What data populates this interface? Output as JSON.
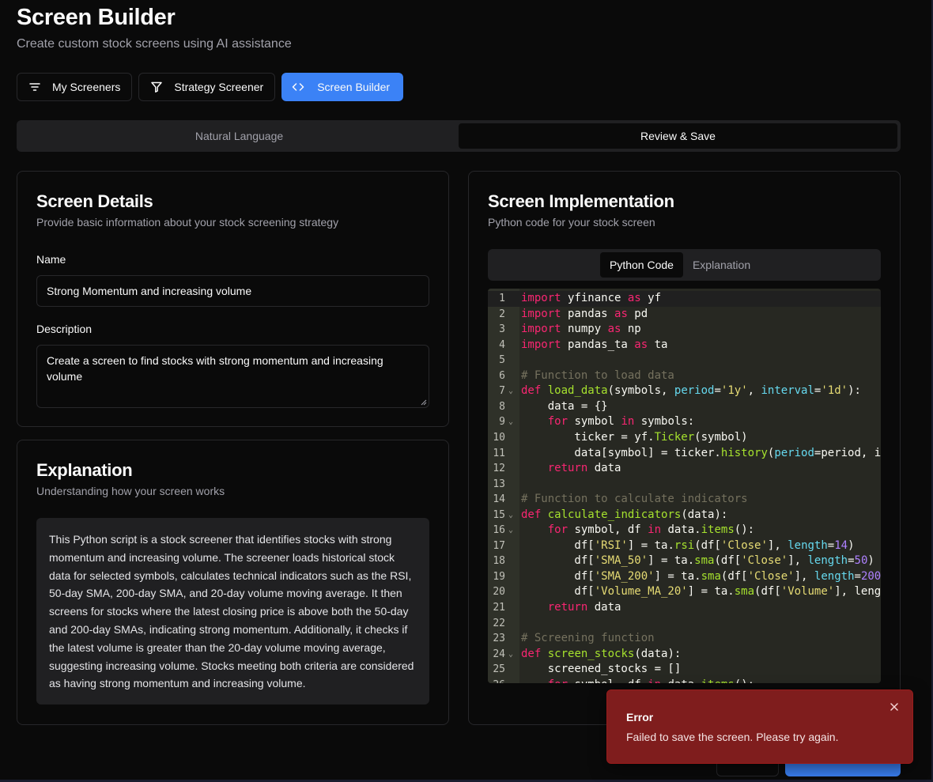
{
  "header": {
    "title": "Screen Builder",
    "subtitle": "Create custom stock screens using AI assistance"
  },
  "nav": {
    "items": [
      {
        "label": "My Screeners",
        "icon": "filter-lines-icon",
        "active": false
      },
      {
        "label": "Strategy Screener",
        "icon": "funnel-icon",
        "active": false
      },
      {
        "label": "Screen Builder",
        "icon": "code-icon",
        "active": true
      }
    ]
  },
  "tabs": [
    {
      "label": "Natural Language",
      "active": false
    },
    {
      "label": "Review & Save",
      "active": true
    }
  ],
  "details": {
    "title": "Screen Details",
    "description": "Provide basic information about your stock screening strategy",
    "name_label": "Name",
    "name_value": "Strong Momentum and increasing volume",
    "description_label": "Description",
    "description_value": "Create a screen to find stocks with strong momentum and increasing volume"
  },
  "explanation": {
    "title": "Explanation",
    "description": "Understanding how your screen works",
    "text": "This Python script is a stock screener that identifies stocks with strong momentum and increasing volume. The screener loads historical stock data for selected symbols, calculates technical indicators such as the RSI, 50-day SMA, 200-day SMA, and 20-day volume moving average. It then screens for stocks where the latest closing price is above both the 50-day and 200-day SMAs, indicating strong momentum. Additionally, it checks if the latest volume is greater than the 20-day volume moving average, suggesting increasing volume. Stocks meeting both criteria are considered as having strong momentum and increasing volume."
  },
  "implementation": {
    "title": "Screen Implementation",
    "description": "Python code for your stock screen",
    "tabs": [
      {
        "label": "Python Code",
        "active": true
      },
      {
        "label": "Explanation",
        "active": false
      }
    ],
    "code_lines": [
      "import yfinance as yf",
      "import pandas as pd",
      "import numpy as np",
      "import pandas_ta as ta",
      "",
      "# Function to load data",
      "def load_data(symbols, period='1y', interval='1d'):",
      "    data = {}",
      "    for symbol in symbols:",
      "        ticker = yf.Ticker(symbol)",
      "        data[symbol] = ticker.history(period=period, i",
      "    return data",
      "",
      "# Function to calculate indicators",
      "def calculate_indicators(data):",
      "    for symbol, df in data.items():",
      "        df['RSI'] = ta.rsi(df['Close'], length=14)",
      "        df['SMA_50'] = ta.sma(df['Close'], length=50)",
      "        df['SMA_200'] = ta.sma(df['Close'], length=200",
      "        df['Volume_MA_20'] = ta.sma(df['Volume'], leng",
      "    return data",
      "",
      "# Screening function",
      "def screen_stocks(data):",
      "    screened_stocks = []",
      "    for symbol, df in data.items():"
    ],
    "fold_lines": [
      7,
      9,
      15,
      16,
      24
    ]
  },
  "toast": {
    "title": "Error",
    "message": "Failed to save the screen. Please try again.",
    "color": "#7f1d1d"
  },
  "colors": {
    "accent": "#3b82f6",
    "background": "#0a0a0a",
    "editor_bg": "#272822"
  }
}
